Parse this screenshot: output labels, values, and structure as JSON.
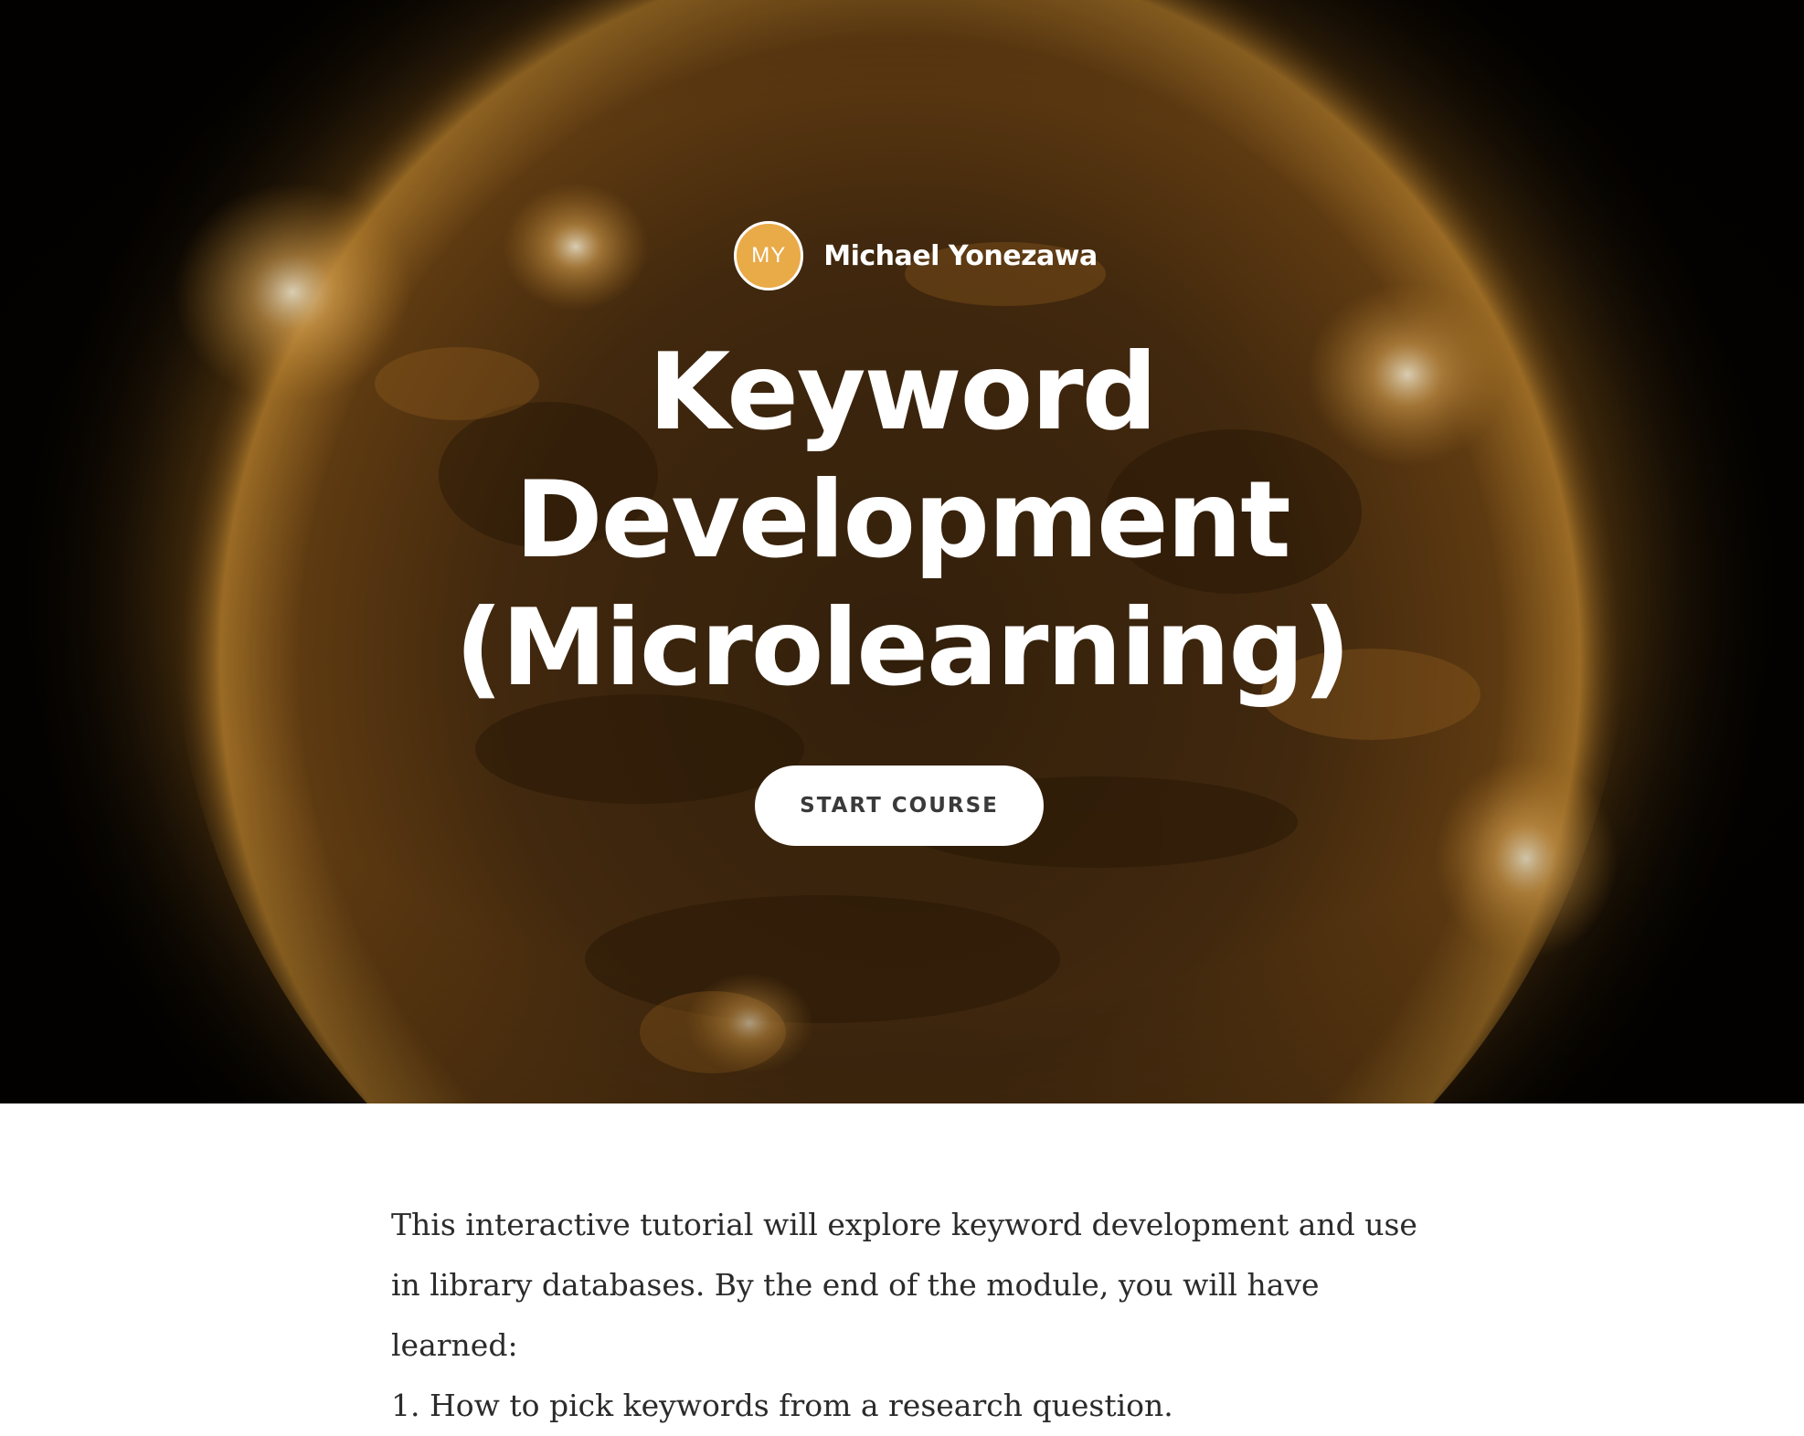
{
  "author": {
    "initials": "MY",
    "name": "Michael Yonezawa",
    "avatar_color": "#e9aa48"
  },
  "course": {
    "title_lines": [
      "Keyword",
      "Development",
      "(Microlearning)"
    ],
    "start_label": "START COURSE"
  },
  "description": {
    "intro": "This interactive tutorial will explore keyword development and use in library databases. By the end of the module, you will have learned:",
    "items": [
      "1. How to pick keywords from a research question."
    ]
  },
  "colors": {
    "hero_background": "#050301",
    "sun_glow": "#c98a2a",
    "button_text": "#3a3a3a",
    "body_text": "#2b2b2b"
  }
}
